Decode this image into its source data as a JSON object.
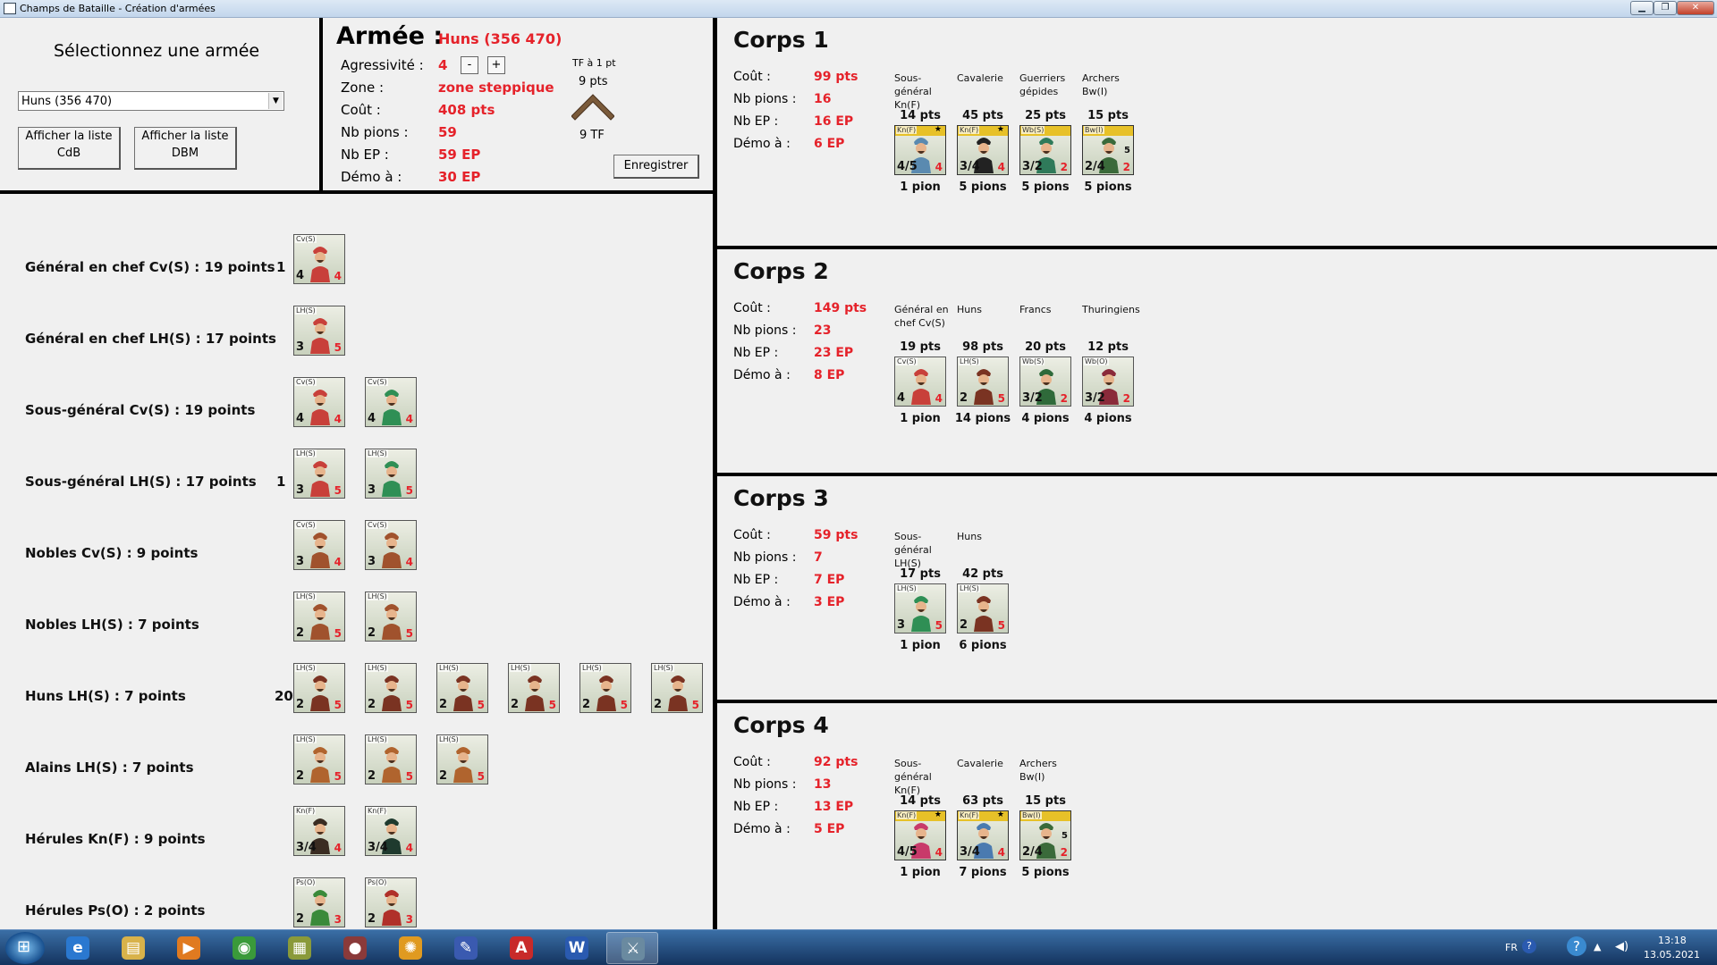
{
  "window": {
    "title": "Champs de Bataille - Création d'armées"
  },
  "selector": {
    "heading": "Sélectionnez une armée",
    "combo_value": "Huns (356 470)",
    "btn_cdb": [
      "Afficher la liste",
      "CdB"
    ],
    "btn_dbm": [
      "Afficher la liste",
      "DBM"
    ]
  },
  "army": {
    "heading": "Armée  :",
    "name": "Huns (356 470)",
    "rows": [
      {
        "label": "Agressivité  :",
        "value": "4"
      },
      {
        "label": "Zone  :",
        "value": "zone steppique"
      },
      {
        "label": "Coût  :",
        "value": "408 pts"
      },
      {
        "label": "Nb pions  :",
        "value": "59"
      },
      {
        "label": "Nb EP  :",
        "value": "59 EP"
      },
      {
        "label": "Démo à  :",
        "value": "30 EP"
      }
    ],
    "minus": "-",
    "plus": "+",
    "tf_caption": "TF à 1 pt",
    "tf_pts": "9 pts",
    "tf_count": "9 TF",
    "save": "Enregistrer"
  },
  "units": [
    {
      "name": "Général en chef Cv(S)  :  19 points",
      "count": "1",
      "tiles": [
        {
          "tag": "Cv(S)",
          "s1": "4",
          "s2": "4",
          "color": "#c8403a"
        }
      ]
    },
    {
      "name": "Général en chef LH(S)  :  17 points",
      "count": "",
      "tiles": [
        {
          "tag": "LH(S)",
          "s1": "3",
          "s2": "5",
          "color": "#c8403a"
        }
      ]
    },
    {
      "name": "Sous-général Cv(S)  :  19 points",
      "count": "",
      "tiles": [
        {
          "tag": "Cv(S)",
          "s1": "4",
          "s2": "4",
          "color": "#c8403a"
        },
        {
          "tag": "Cv(S)",
          "s1": "4",
          "s2": "4",
          "color": "#2f8f55"
        }
      ]
    },
    {
      "name": "Sous-général LH(S)  :  17 points",
      "count": "1",
      "tiles": [
        {
          "tag": "LH(S)",
          "s1": "3",
          "s2": "5",
          "color": "#c8403a"
        },
        {
          "tag": "LH(S)",
          "s1": "3",
          "s2": "5",
          "color": "#2f8f55"
        }
      ]
    },
    {
      "name": "Nobles Cv(S)  :  9 points",
      "count": "",
      "tiles": [
        {
          "tag": "Cv(S)",
          "s1": "3",
          "s2": "4",
          "color": "#a0522d"
        },
        {
          "tag": "Cv(S)",
          "s1": "3",
          "s2": "4",
          "color": "#a0522d"
        }
      ]
    },
    {
      "name": "Nobles LH(S)  :  7 points",
      "count": "",
      "tiles": [
        {
          "tag": "LH(S)",
          "s1": "2",
          "s2": "5",
          "color": "#a0522d"
        },
        {
          "tag": "LH(S)",
          "s1": "2",
          "s2": "5",
          "color": "#a0522d"
        }
      ]
    },
    {
      "name": "Huns LH(S)  :  7 points",
      "count": "20",
      "tiles": [
        {
          "tag": "LH(S)",
          "s1": "2",
          "s2": "5",
          "color": "#7a3322"
        },
        {
          "tag": "LH(S)",
          "s1": "2",
          "s2": "5",
          "color": "#7a3322"
        },
        {
          "tag": "LH(S)",
          "s1": "2",
          "s2": "5",
          "color": "#7a3322"
        },
        {
          "tag": "LH(S)",
          "s1": "2",
          "s2": "5",
          "color": "#7a3322"
        },
        {
          "tag": "LH(S)",
          "s1": "2",
          "s2": "5",
          "color": "#7a3322"
        },
        {
          "tag": "LH(S)",
          "s1": "2",
          "s2": "5",
          "color": "#7a3322"
        }
      ]
    },
    {
      "name": "Alains LH(S)  :  7 points",
      "count": "",
      "tiles": [
        {
          "tag": "LH(S)",
          "s1": "2",
          "s2": "5",
          "color": "#b0642e"
        },
        {
          "tag": "LH(S)",
          "s1": "2",
          "s2": "5",
          "color": "#b0642e"
        },
        {
          "tag": "LH(S)",
          "s1": "2",
          "s2": "5",
          "color": "#b0642e"
        }
      ]
    },
    {
      "name": "Hérules Kn(F)  :  9 points",
      "count": "",
      "tiles": [
        {
          "tag": "Kn(F)",
          "s1": "3/4",
          "s2": "4",
          "color": "#3a2c22"
        },
        {
          "tag": "Kn(F)",
          "s1": "3/4",
          "s2": "4",
          "color": "#1f3a2e"
        }
      ]
    },
    {
      "name": "Hérules Ps(O)  :  2 points",
      "count": "",
      "tiles": [
        {
          "tag": "Ps(O)",
          "s1": "2",
          "s2": "3",
          "color": "#3a8a3a"
        },
        {
          "tag": "Ps(O)",
          "s1": "2",
          "s2": "3",
          "color": "#b0302a"
        }
      ]
    }
  ],
  "corps": [
    {
      "title": "Corps  1",
      "rows": [
        {
          "label": "Coût  :",
          "value": "99 pts"
        },
        {
          "label": "Nb pions  :",
          "value": "16"
        },
        {
          "label": "Nb EP  :",
          "value": "16 EP"
        },
        {
          "label": "Démo à  :",
          "value": "6 EP"
        }
      ],
      "units": [
        {
          "name": "Sous-général Kn(F)",
          "pts": "14 pts",
          "pions": "1 pion",
          "tag": "Kn(F)",
          "s1": "4/5",
          "s2": "4",
          "s3": "",
          "yellow": true,
          "star": true,
          "color": "#5a8ab0"
        },
        {
          "name": "Cavalerie",
          "pts": "45 pts",
          "pions": "5 pions",
          "tag": "Kn(F)",
          "s1": "3/4",
          "s2": "4",
          "s3": "",
          "yellow": true,
          "star": true,
          "color": "#222222"
        },
        {
          "name": "Guerriers gépides",
          "pts": "25 pts",
          "pions": "5 pions",
          "tag": "Wb(S)",
          "s1": "3/2",
          "s2": "2",
          "s3": "",
          "yellow": true,
          "star": false,
          "color": "#2f7a5a"
        },
        {
          "name": "Archers Bw(I)",
          "pts": "15 pts",
          "pions": "5 pions",
          "tag": "Bw(I)",
          "s1": "2/4",
          "s2": "2",
          "s3": "5",
          "yellow": true,
          "star": false,
          "color": "#3a6a3a"
        }
      ]
    },
    {
      "title": "Corps  2",
      "rows": [
        {
          "label": "Coût  :",
          "value": "149 pts"
        },
        {
          "label": "Nb pions  :",
          "value": "23"
        },
        {
          "label": "Nb EP  :",
          "value": "23 EP"
        },
        {
          "label": "Démo à  :",
          "value": "8 EP"
        }
      ],
      "units": [
        {
          "name": "Général en chef Cv(S)",
          "pts": "19 pts",
          "pions": "1 pion",
          "tag": "Cv(S)",
          "s1": "4",
          "s2": "4",
          "s3": "",
          "yellow": false,
          "star": false,
          "color": "#c8403a"
        },
        {
          "name": "Huns",
          "pts": "98 pts",
          "pions": "14 pions",
          "tag": "LH(S)",
          "s1": "2",
          "s2": "5",
          "s3": "",
          "yellow": false,
          "star": false,
          "color": "#7a3322"
        },
        {
          "name": "Francs",
          "pts": "20 pts",
          "pions": "4 pions",
          "tag": "Wb(S)",
          "s1": "3/2",
          "s2": "2",
          "s3": "",
          "yellow": false,
          "star": false,
          "color": "#2f6a3a"
        },
        {
          "name": "Thuringiens",
          "pts": "12 pts",
          "pions": "4 pions",
          "tag": "Wb(O)",
          "s1": "3/2",
          "s2": "2",
          "s3": "",
          "yellow": false,
          "star": false,
          "color": "#8a2a3a"
        }
      ]
    },
    {
      "title": "Corps  3",
      "rows": [
        {
          "label": "Coût  :",
          "value": "59 pts"
        },
        {
          "label": "Nb pions  :",
          "value": "7"
        },
        {
          "label": "Nb EP  :",
          "value": "7 EP"
        },
        {
          "label": "Démo à  :",
          "value": "3 EP"
        }
      ],
      "units": [
        {
          "name": "Sous-général LH(S)",
          "pts": "17 pts",
          "pions": "1 pion",
          "tag": "LH(S)",
          "s1": "3",
          "s2": "5",
          "s3": "",
          "yellow": false,
          "star": false,
          "color": "#2f8f55"
        },
        {
          "name": "Huns",
          "pts": "42 pts",
          "pions": "6 pions",
          "tag": "LH(S)",
          "s1": "2",
          "s2": "5",
          "s3": "",
          "yellow": false,
          "star": false,
          "color": "#7a3322"
        }
      ]
    },
    {
      "title": "Corps  4",
      "rows": [
        {
          "label": "Coût  :",
          "value": "92 pts"
        },
        {
          "label": "Nb pions  :",
          "value": "13"
        },
        {
          "label": "Nb EP  :",
          "value": "13 EP"
        },
        {
          "label": "Démo à  :",
          "value": "5 EP"
        }
      ],
      "units": [
        {
          "name": "Sous-général Kn(F)",
          "pts": "14 pts",
          "pions": "1 pion",
          "tag": "Kn(F)",
          "s1": "4/5",
          "s2": "4",
          "s3": "",
          "yellow": true,
          "star": true,
          "color": "#c83a6a"
        },
        {
          "name": "Cavalerie",
          "pts": "63 pts",
          "pions": "7 pions",
          "tag": "Kn(F)",
          "s1": "3/4",
          "s2": "4",
          "s3": "",
          "yellow": true,
          "star": true,
          "color": "#4a7ab0"
        },
        {
          "name": "Archers Bw(I)",
          "pts": "15 pts",
          "pions": "5 pions",
          "tag": "Bw(I)",
          "s1": "2/4",
          "s2": "2",
          "s3": "5",
          "yellow": true,
          "star": false,
          "color": "#3a6a3a"
        }
      ]
    }
  ],
  "taskbar": {
    "apps": [
      {
        "icon": "internet-explorer-icon",
        "glyph": "e",
        "color": "#2a78d0"
      },
      {
        "icon": "explorer-folder-icon",
        "glyph": "▤",
        "color": "#d8b24a"
      },
      {
        "icon": "media-player-icon",
        "glyph": "▶",
        "color": "#e07a20"
      },
      {
        "icon": "chrome-icon",
        "glyph": "◉",
        "color": "#3a9a3a"
      },
      {
        "icon": "app-icon",
        "glyph": "▦",
        "color": "#8a9a3a"
      },
      {
        "icon": "paint-icon",
        "glyph": "●",
        "color": "#8a3a3a"
      },
      {
        "icon": "gear-app-icon",
        "glyph": "✺",
        "color": "#e09a20"
      },
      {
        "icon": "editor-icon",
        "glyph": "✎",
        "color": "#3a5ab0"
      },
      {
        "icon": "pdf-icon",
        "glyph": "A",
        "color": "#c82a2a"
      },
      {
        "icon": "word-icon",
        "glyph": "W",
        "color": "#2a5ab0"
      },
      {
        "icon": "army-builder-icon",
        "glyph": "⚔",
        "color": "#6a8aa0"
      }
    ],
    "lang": "FR",
    "time": "13:18",
    "date": "13.05.2021"
  }
}
